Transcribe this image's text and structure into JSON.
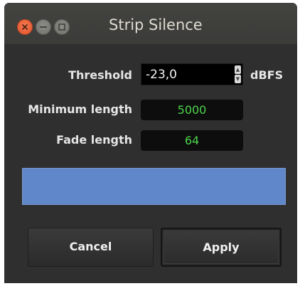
{
  "window": {
    "title": "Strip Silence",
    "buttons": [
      "close-icon",
      "minimize-icon",
      "maximize-icon"
    ],
    "close_color": "#e0522a"
  },
  "form": {
    "threshold_label": "Threshold",
    "threshold_value": "-23,0",
    "threshold_unit": "dBFS",
    "min_length_label": "Minimum length",
    "min_length_value": "5000",
    "fade_length_label": "Fade length",
    "fade_length_value": "64",
    "value_color": "#4cd64c"
  },
  "progress": {
    "color": "#6087c9"
  },
  "actions": {
    "cancel_label": "Cancel",
    "apply_label": "Apply"
  }
}
